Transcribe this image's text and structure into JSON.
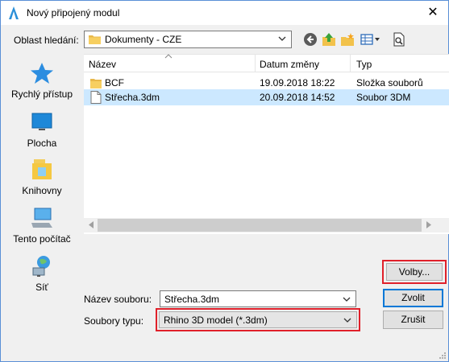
{
  "window": {
    "title": "Nový připojený modul",
    "close_glyph": "✕"
  },
  "lookin": {
    "label": "Oblast hledání:",
    "value": "Dokumenty - CZE"
  },
  "toolbar": {
    "icons": [
      "back-icon",
      "up-folder-icon",
      "new-folder-icon",
      "views-menu-icon",
      "preview-icon"
    ]
  },
  "sidebar": {
    "items": [
      {
        "label": "Rychlý přístup",
        "icon": "star-icon"
      },
      {
        "label": "Plocha",
        "icon": "desktop-icon"
      },
      {
        "label": "Knihovny",
        "icon": "libraries-icon"
      },
      {
        "label": "Tento počítač",
        "icon": "computer-icon"
      },
      {
        "label": "Síť",
        "icon": "network-icon"
      }
    ]
  },
  "filelist": {
    "columns": [
      "Název",
      "Datum změny",
      "Typ"
    ],
    "rows": [
      {
        "name": "BCF",
        "date": "19.09.2018 18:22",
        "type": "Složka souborů",
        "icon": "folder-icon",
        "selected": false
      },
      {
        "name": "Střecha.3dm",
        "date": "20.09.2018 14:52",
        "type": "Soubor 3DM",
        "icon": "file-icon",
        "selected": true
      }
    ]
  },
  "buttons": {
    "options": "Volby...",
    "open": "Zvolit",
    "cancel": "Zrušit"
  },
  "filename": {
    "label": "Název souboru:",
    "value": "Střecha.3dm"
  },
  "filetype": {
    "label": "Soubory typu:",
    "value": "Rhino 3D model (*.3dm)"
  },
  "colors": {
    "highlight": "#e0202a",
    "selection": "#cce8ff",
    "accent": "#0078d7"
  }
}
